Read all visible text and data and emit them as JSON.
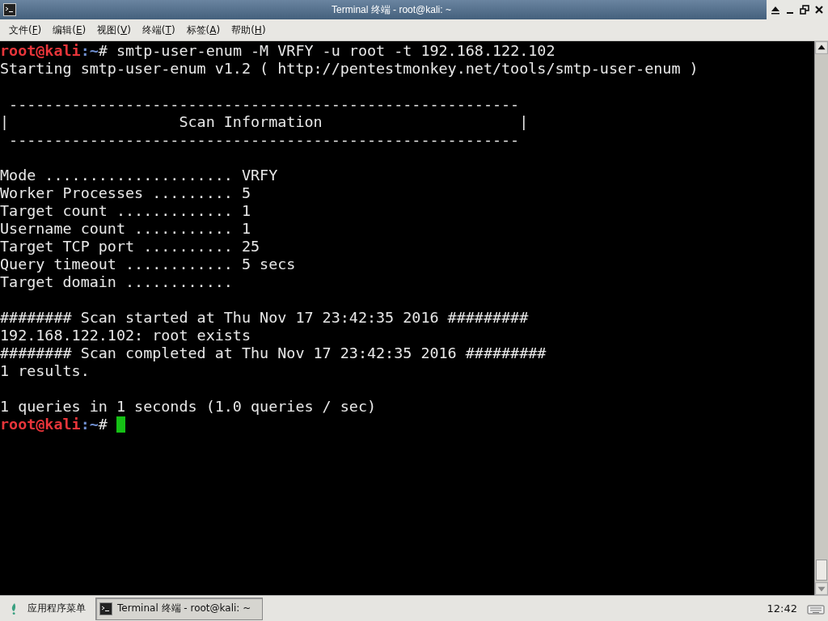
{
  "window": {
    "title": "Terminal 终端 - root@kali: ~"
  },
  "menu": [
    {
      "before": "文件(",
      "key": "F",
      "after": ")"
    },
    {
      "before": "编辑(",
      "key": "E",
      "after": ")"
    },
    {
      "before": "视图(",
      "key": "V",
      "after": ")"
    },
    {
      "before": "终端(",
      "key": "T",
      "after": ")"
    },
    {
      "before": "标签(",
      "key": "A",
      "after": ")"
    },
    {
      "before": "帮助(",
      "key": "H",
      "after": ")"
    }
  ],
  "terminal": {
    "lines": [
      {
        "kind": "prompt",
        "user_host": "root@kali",
        "path": ":~",
        "symbol": "#",
        "command": "smtp-user-enum -M VRFY -u root -t 192.168.122.102"
      },
      {
        "kind": "text",
        "text": "Starting smtp-user-enum v1.2 ( http://pentestmonkey.net/tools/smtp-user-enum )"
      },
      {
        "kind": "blank"
      },
      {
        "kind": "text",
        "text": " ---------------------------------------------------------"
      },
      {
        "kind": "text",
        "text": "|                   Scan Information                      |"
      },
      {
        "kind": "text",
        "text": " ---------------------------------------------------------"
      },
      {
        "kind": "blank"
      },
      {
        "kind": "text",
        "text": "Mode ..................... VRFY"
      },
      {
        "kind": "text",
        "text": "Worker Processes ......... 5"
      },
      {
        "kind": "text",
        "text": "Target count ............. 1"
      },
      {
        "kind": "text",
        "text": "Username count ........... 1"
      },
      {
        "kind": "text",
        "text": "Target TCP port .......... 25"
      },
      {
        "kind": "text",
        "text": "Query timeout ............ 5 secs"
      },
      {
        "kind": "text",
        "text": "Target domain ............"
      },
      {
        "kind": "blank"
      },
      {
        "kind": "text",
        "text": "######## Scan started at Thu Nov 17 23:42:35 2016 #########"
      },
      {
        "kind": "text",
        "text": "192.168.122.102: root exists"
      },
      {
        "kind": "text",
        "text": "######## Scan completed at Thu Nov 17 23:42:35 2016 #########"
      },
      {
        "kind": "text",
        "text": "1 results."
      },
      {
        "kind": "blank"
      },
      {
        "kind": "text",
        "text": "1 queries in 1 seconds (1.0 queries / sec)"
      },
      {
        "kind": "prompt",
        "user_host": "root@kali",
        "path": ":~",
        "symbol": "#",
        "cursor": true
      }
    ]
  },
  "taskbar": {
    "app_menu": "应用程序菜单",
    "tasks": [
      {
        "label": "Terminal 终端 - root@kali: ~",
        "selected": true
      }
    ],
    "clock": "12:42"
  }
}
